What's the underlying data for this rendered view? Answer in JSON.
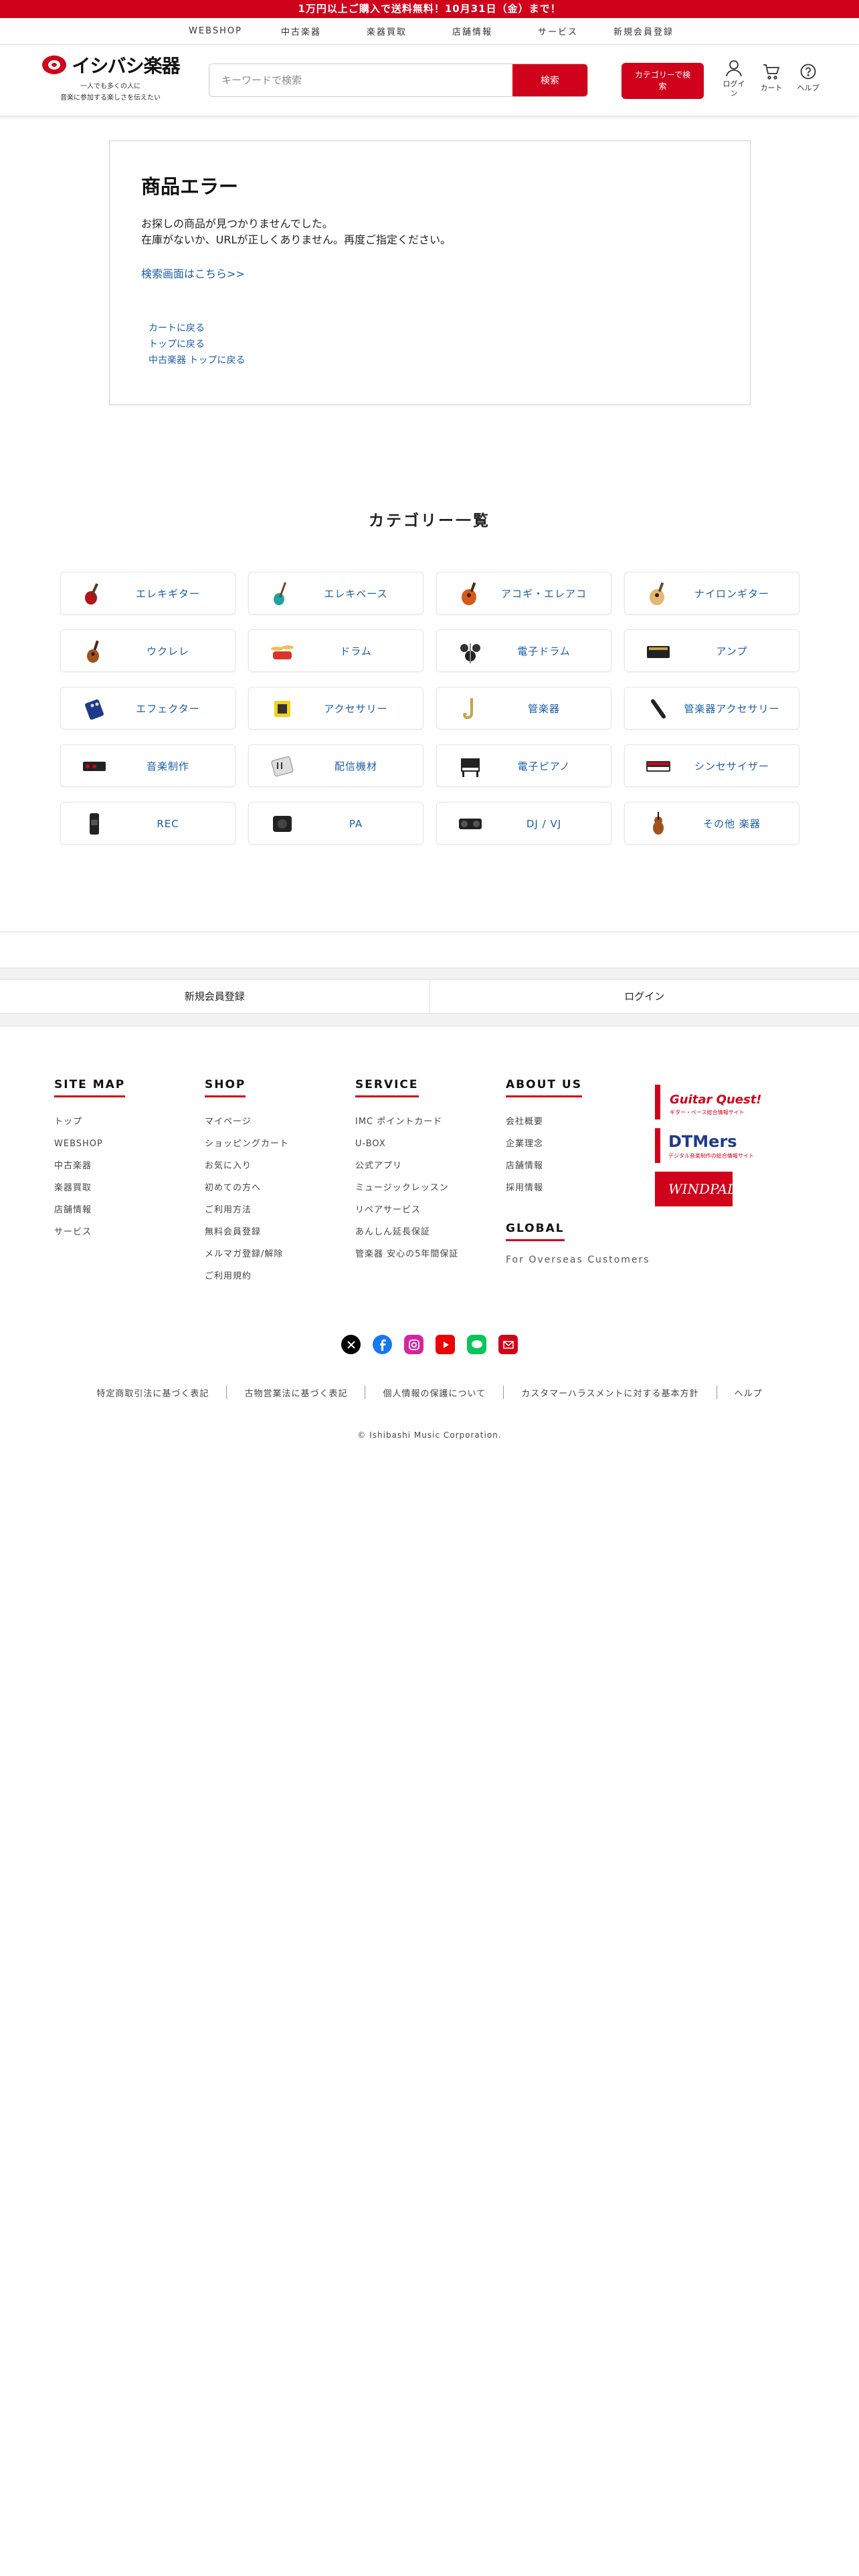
{
  "promo": "1万円以上ご購入で送料無料！10月31日（金）まで！",
  "topnav": [
    "WEBSHOP",
    "中古楽器",
    "楽器買取",
    "店舗情報",
    "サービス",
    "新規会員登録"
  ],
  "header": {
    "logo_text": "イシバシ楽器",
    "tagline_1": "一人でも多くの人に",
    "tagline_2": "音楽に参加する楽しさを伝えたい",
    "search_placeholder": "キーワードで検索",
    "search_button": "検索",
    "category_search_line1": "カテゴリーで検",
    "category_search_line2": "索",
    "login_line1": "ログイ",
    "login_line2": "ン",
    "cart": "カート",
    "help": "ヘルプ",
    "accent_color": "#d0021b"
  },
  "error": {
    "title": "商品エラー",
    "msg1": "お探しの商品が見つかりませんでした。",
    "msg2": "在庫がないか、URLが正しくありません。再度ご指定ください。",
    "search_link": "検索画面はこちら>>",
    "links": [
      "カートに戻る",
      "トップに戻る",
      "中古楽器 トップに戻る"
    ]
  },
  "categories": {
    "title": "カテゴリー一覧",
    "items": [
      {
        "label": "エレキギター",
        "icon": "electric-guitar-icon"
      },
      {
        "label": "エレキベース",
        "icon": "electric-bass-icon"
      },
      {
        "label": "アコギ・エレアコ",
        "icon": "acoustic-guitar-icon"
      },
      {
        "label": "ナイロンギター",
        "icon": "nylon-guitar-icon"
      },
      {
        "label": "ウクレレ",
        "icon": "ukulele-icon"
      },
      {
        "label": "ドラム",
        "icon": "drum-icon"
      },
      {
        "label": "電子ドラム",
        "icon": "electronic-drum-icon"
      },
      {
        "label": "アンプ",
        "icon": "amp-icon"
      },
      {
        "label": "エフェクター",
        "icon": "effector-icon"
      },
      {
        "label": "アクセサリー",
        "icon": "accessory-icon"
      },
      {
        "label": "管楽器",
        "icon": "saxophone-icon"
      },
      {
        "label": "管楽器アクセサリー",
        "icon": "wind-accessory-icon"
      },
      {
        "label": "音楽制作",
        "icon": "audio-interface-icon"
      },
      {
        "label": "配信機材",
        "icon": "streaming-mixer-icon"
      },
      {
        "label": "電子ピアノ",
        "icon": "digital-piano-icon"
      },
      {
        "label": "シンセサイザー",
        "icon": "synthesizer-icon"
      },
      {
        "label": "REC",
        "icon": "recorder-icon"
      },
      {
        "label": "PA",
        "icon": "pa-speaker-icon"
      },
      {
        "label": "DJ / VJ",
        "icon": "dj-controller-icon"
      },
      {
        "label": "その他 楽器",
        "icon": "violin-icon"
      }
    ]
  },
  "member": {
    "register": "新規会員登録",
    "login": "ログイン"
  },
  "footer": {
    "sitemap": {
      "title": "SITE MAP",
      "links": [
        "トップ",
        "WEBSHOP",
        "中古楽器",
        "楽器買取",
        "店舗情報",
        "サービス"
      ]
    },
    "shop": {
      "title": "SHOP",
      "links": [
        "マイページ",
        "ショッピングカート",
        "お気に入り",
        "初めての方へ",
        "ご利用方法",
        "無料会員登録",
        "メルマガ登録/解除",
        "ご利用規約"
      ]
    },
    "service": {
      "title": "SERVICE",
      "links": [
        "IMC ポイントカード",
        "U-BOX",
        "公式アプリ",
        "ミュージックレッスン",
        "リペアサービス",
        "あんしん延長保証",
        "管楽器 安心の5年間保証"
      ]
    },
    "about": {
      "title": "ABOUT US",
      "links": [
        "会社概要",
        "企業理念",
        "店舗情報",
        "採用情報"
      ]
    },
    "global": {
      "title": "GLOBAL",
      "sub": "For Overseas Customers"
    },
    "banners": {
      "b1_title": "Guitar Quest!",
      "b1_sub": "ギター・ベース総合情報サイト",
      "b2_title": "DTMers",
      "b2_sub": "デジタル音楽制作の総合情報サイト",
      "b3_title": "WINDPAL"
    },
    "social": [
      "x-icon",
      "facebook-icon",
      "instagram-icon",
      "youtube-icon",
      "line-icon",
      "mail-icon"
    ],
    "legal": [
      "特定商取引法に基づく表記",
      "古物営業法に基づく表記",
      "個人情報の保護について",
      "カスタマーハラスメントに対する基本方針",
      "ヘルプ"
    ],
    "copyright": "© Ishibashi Music Corporation."
  }
}
